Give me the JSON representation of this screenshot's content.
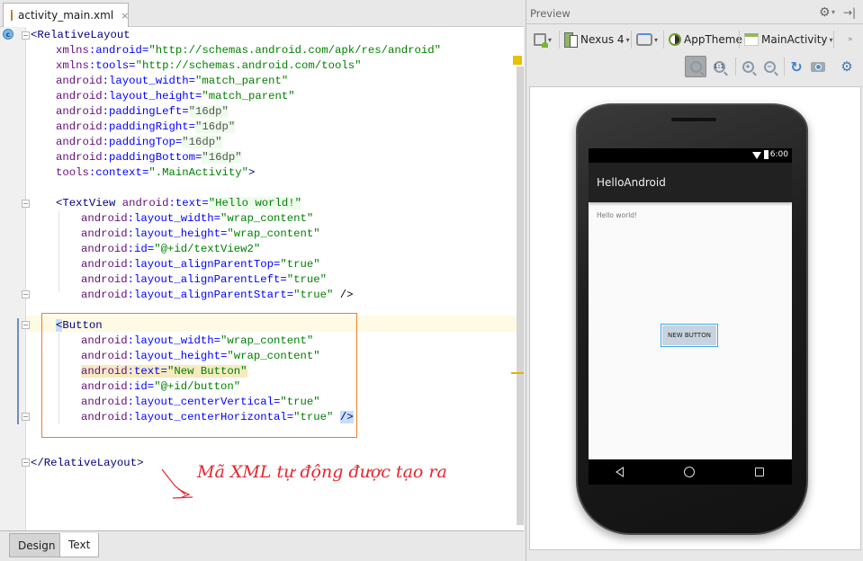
{
  "editor": {
    "file_tab": {
      "label": "activity_main.xml",
      "icon": "xml-file-icon",
      "close": "×"
    },
    "code_lines": [
      {
        "parts": [
          [
            "tag",
            "<RelativeLayout"
          ]
        ]
      },
      {
        "parts": [
          [
            "ns",
            "xmlns"
          ],
          [
            "attr",
            ":android="
          ],
          [
            "val",
            "\"http://schemas.android.com/apk/res/android\""
          ]
        ]
      },
      {
        "parts": [
          [
            "ns",
            "xmlns"
          ],
          [
            "attr",
            ":tools="
          ],
          [
            "val",
            "\"http://schemas.android.com/tools\""
          ]
        ]
      },
      {
        "parts": [
          [
            "ns",
            "android"
          ],
          [
            "attr",
            ":layout_width="
          ],
          [
            "val",
            "\"match_parent\""
          ]
        ]
      },
      {
        "parts": [
          [
            "ns",
            "android"
          ],
          [
            "attr",
            ":layout_height="
          ],
          [
            "val",
            "\"match_parent\""
          ]
        ]
      },
      {
        "parts": [
          [
            "ns",
            "android"
          ],
          [
            "attr",
            ":paddingLeft="
          ],
          [
            "dim",
            "\"16dp\""
          ]
        ]
      },
      {
        "parts": [
          [
            "ns",
            "android"
          ],
          [
            "attr",
            ":paddingRight="
          ],
          [
            "dim",
            "\"16dp\""
          ]
        ]
      },
      {
        "parts": [
          [
            "ns",
            "android"
          ],
          [
            "attr",
            ":paddingTop="
          ],
          [
            "dim",
            "\"16dp\""
          ]
        ]
      },
      {
        "parts": [
          [
            "ns",
            "android"
          ],
          [
            "attr",
            ":paddingBottom="
          ],
          [
            "dim",
            "\"16dp\""
          ]
        ]
      },
      {
        "parts": [
          [
            "ns",
            "tools"
          ],
          [
            "attr",
            ":context="
          ],
          [
            "val",
            "\".MainActivity\""
          ],
          [
            "tag",
            ">"
          ]
        ]
      },
      {
        "parts": []
      },
      {
        "parts": [
          [
            "tag",
            "<TextView "
          ],
          [
            "ns",
            "android"
          ],
          [
            "attr",
            ":text="
          ],
          [
            "dimv",
            "\"Hello world!\""
          ]
        ]
      },
      {
        "parts": [
          [
            "ns",
            "android"
          ],
          [
            "attr",
            ":layout_width="
          ],
          [
            "val",
            "\"wrap_content\""
          ]
        ]
      },
      {
        "parts": [
          [
            "ns",
            "android"
          ],
          [
            "attr",
            ":layout_height="
          ],
          [
            "val",
            "\"wrap_content\""
          ]
        ]
      },
      {
        "parts": [
          [
            "ns",
            "android"
          ],
          [
            "attr",
            ":id="
          ],
          [
            "val",
            "\"@+id/textView2\""
          ]
        ]
      },
      {
        "parts": [
          [
            "ns",
            "android"
          ],
          [
            "attr",
            ":layout_alignParentTop="
          ],
          [
            "val",
            "\"true\""
          ]
        ]
      },
      {
        "parts": [
          [
            "ns",
            "android"
          ],
          [
            "attr",
            ":layout_alignParentLeft="
          ],
          [
            "val",
            "\"true\""
          ]
        ]
      },
      {
        "parts": [
          [
            "ns",
            "android"
          ],
          [
            "attr",
            ":layout_alignParentStart="
          ],
          [
            "val",
            "\"true\""
          ],
          [
            "punct",
            " />"
          ]
        ]
      },
      {
        "parts": []
      },
      {
        "parts": [
          [
            "sel",
            "<"
          ],
          [
            "tag",
            "Button"
          ]
        ]
      },
      {
        "parts": [
          [
            "ns",
            "android"
          ],
          [
            "attr",
            ":layout_width="
          ],
          [
            "val",
            "\"wrap_content\""
          ]
        ]
      },
      {
        "parts": [
          [
            "ns",
            "android"
          ],
          [
            "attr",
            ":layout_height="
          ],
          [
            "val",
            "\"wrap_content\""
          ]
        ]
      },
      {
        "parts": [
          [
            "warn-ns",
            "android"
          ],
          [
            "warn-attr",
            ":text="
          ],
          [
            "warn-val",
            "\"New Button\""
          ]
        ]
      },
      {
        "parts": [
          [
            "ns",
            "android"
          ],
          [
            "attr",
            ":id="
          ],
          [
            "val",
            "\"@+id/button\""
          ]
        ]
      },
      {
        "parts": [
          [
            "ns",
            "android"
          ],
          [
            "attr",
            ":layout_centerVertical="
          ],
          [
            "val",
            "\"true\""
          ]
        ]
      },
      {
        "parts": [
          [
            "ns",
            "android"
          ],
          [
            "attr",
            ":layout_centerHorizontal="
          ],
          [
            "val",
            "\"true\""
          ],
          [
            "punct",
            " "
          ],
          [
            "sel",
            "/>"
          ]
        ]
      },
      {
        "parts": []
      },
      {
        "parts": []
      },
      {
        "parts": [
          [
            "tag",
            "</RelativeLayout>"
          ]
        ]
      }
    ],
    "annotation": "Mã XML tự động được tạo ra",
    "bottom_tabs": [
      {
        "label": "Design",
        "active": false
      },
      {
        "label": "Text",
        "active": true
      }
    ]
  },
  "preview": {
    "title": "Preview",
    "toolbar": {
      "device": "Nexus 4",
      "theme": "AppTheme",
      "activity": "MainActivity",
      "more": "»"
    },
    "zoom_tools": [
      "zoom-to-fit",
      "actual-size",
      "zoom-in",
      "zoom-out",
      "refresh",
      "screenshot",
      "options"
    ],
    "phone": {
      "status_time": "6:00",
      "app_title": "HelloAndroid",
      "text_view": "Hello world!",
      "button_label": "NEW BUTTON"
    }
  },
  "colors": {
    "highlight_box": "#f07d24",
    "annotation": "#e3262d",
    "selection": "#c5dffa",
    "caret_row": "#fffae3"
  }
}
